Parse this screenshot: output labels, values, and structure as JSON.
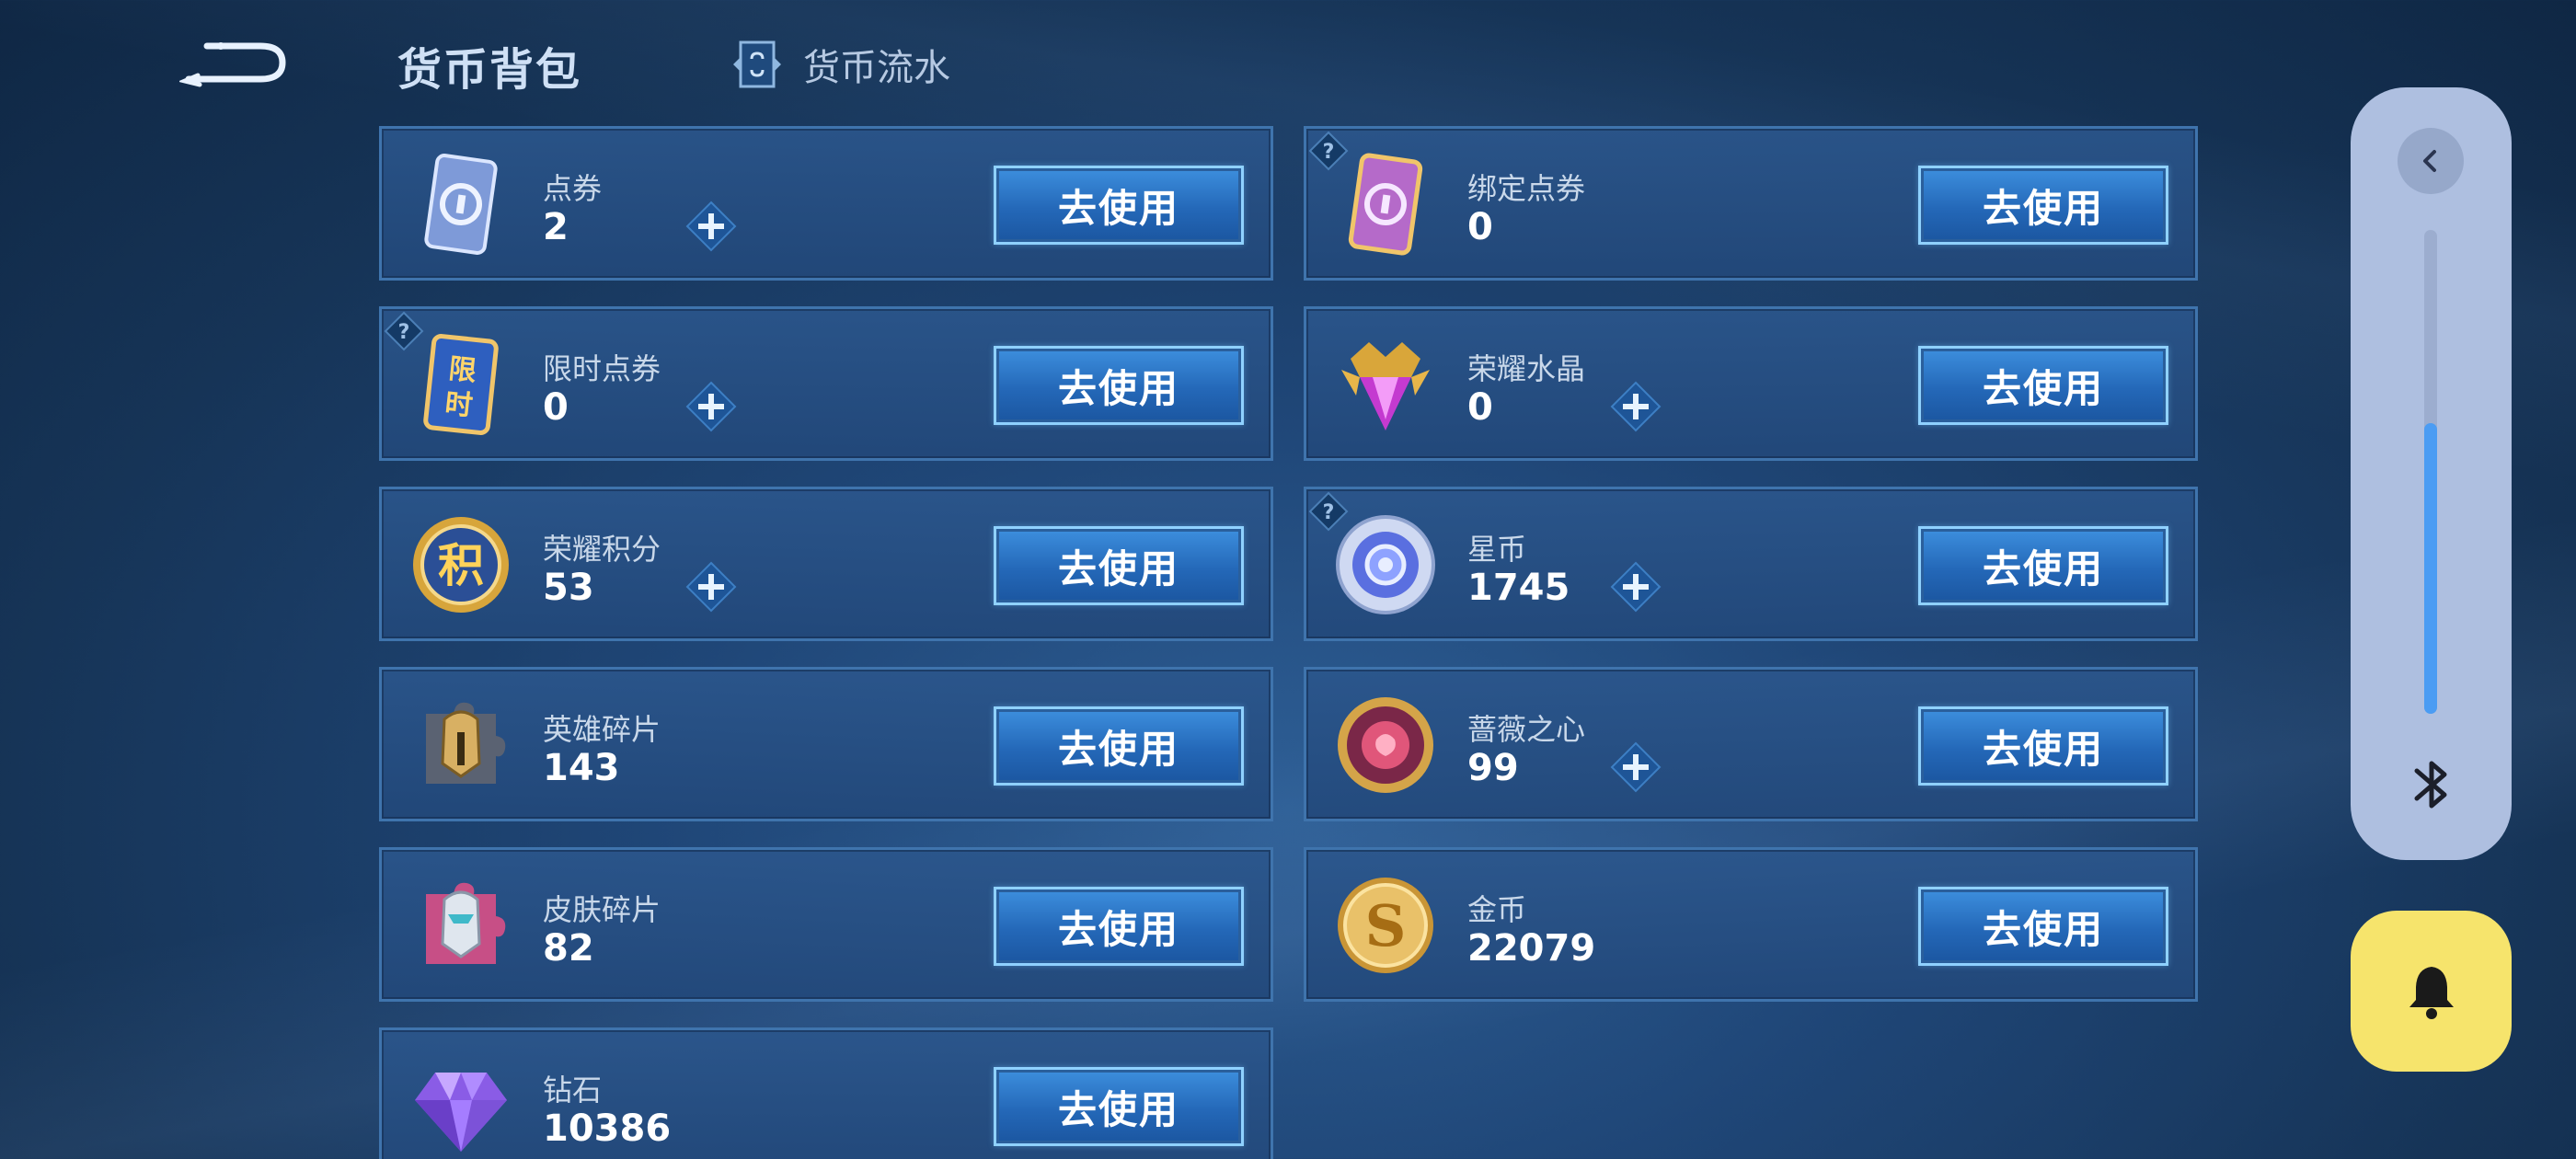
{
  "header": {
    "title": "货币背包",
    "flow_tab_label": "货币流水"
  },
  "button_label": "去使用",
  "currencies": [
    {
      "name": "点券",
      "amount": "2",
      "icon": "voucher-card-blue-icon",
      "has_plus": true,
      "has_help": false
    },
    {
      "name": "绑定点券",
      "amount": "0",
      "icon": "voucher-card-purple-icon",
      "has_plus": false,
      "has_help": true
    },
    {
      "name": "限时点券",
      "amount": "0",
      "icon": "limited-voucher-icon",
      "icon_text": "限时",
      "has_plus": true,
      "has_help": true
    },
    {
      "name": "荣耀水晶",
      "amount": "0",
      "icon": "glory-crystal-icon",
      "has_plus": true,
      "has_help": false
    },
    {
      "name": "荣耀积分",
      "amount": "53",
      "icon": "glory-points-icon",
      "icon_text": "积",
      "has_plus": true,
      "has_help": false
    },
    {
      "name": "星币",
      "amount": "1745",
      "icon": "star-coin-icon",
      "has_plus": true,
      "has_help": true
    },
    {
      "name": "英雄碎片",
      "amount": "143",
      "icon": "hero-fragment-icon",
      "has_plus": false,
      "has_help": false
    },
    {
      "name": "蔷薇之心",
      "amount": "99",
      "icon": "rose-heart-icon",
      "has_plus": true,
      "has_help": false
    },
    {
      "name": "皮肤碎片",
      "amount": "82",
      "icon": "skin-fragment-icon",
      "has_plus": false,
      "has_help": false
    },
    {
      "name": "金币",
      "amount": "22079",
      "icon": "gold-coin-icon",
      "icon_text": "S",
      "has_plus": false,
      "has_help": false
    },
    {
      "name": "钻石",
      "amount": "10386",
      "icon": "diamond-icon",
      "has_plus": false,
      "has_help": false
    }
  ],
  "side_panel": {
    "volume_level": 0.6
  },
  "colors": {
    "accent": "#4b9cf3",
    "bell_button": "#f6e46c"
  }
}
